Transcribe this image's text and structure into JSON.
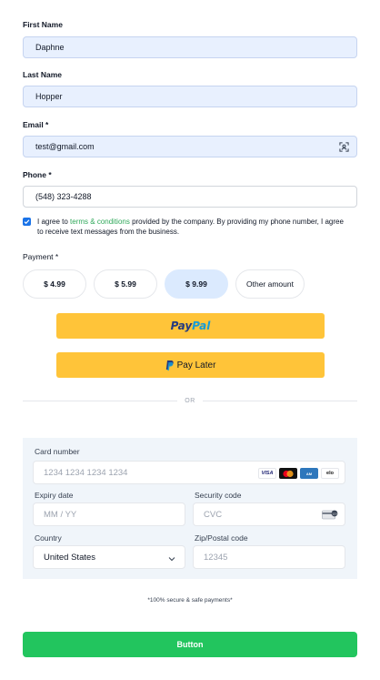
{
  "form": {
    "first_name": {
      "label": "First Name",
      "value": "Daphne"
    },
    "last_name": {
      "label": "Last Name",
      "value": "Hopper"
    },
    "email": {
      "label": "Email *",
      "value": "test@gmail.com"
    },
    "phone": {
      "label": "Phone *",
      "value": "(548) 323-4288"
    }
  },
  "consent": {
    "checked": true,
    "text_before": "I agree to ",
    "link": "terms & conditions",
    "text_after": " provided by the company. By providing my phone number, I agree to receive text messages from the business."
  },
  "payment": {
    "label": "Payment *",
    "amounts": [
      "$ 4.99",
      "$ 5.99",
      "$ 9.99",
      "Other amount"
    ],
    "selected": "$ 9.99"
  },
  "paypal": {
    "logo_part1": "Pay",
    "logo_part2": "Pal",
    "pay_later_label": "Pay Later",
    "button_color": "#ffc439"
  },
  "divider": {
    "text": "OR"
  },
  "card": {
    "number_label": "Card number",
    "number_placeholder": "1234 1234 1234 1234",
    "brands": [
      "VISA",
      "mastercard",
      "amex",
      "elo"
    ],
    "expiry_label": "Expiry date",
    "expiry_placeholder": "MM / YY",
    "cvc_label": "Security code",
    "cvc_placeholder": "CVC",
    "country_label": "Country",
    "country_value": "United States",
    "zip_label": "Zip/Postal code",
    "zip_placeholder": "12345"
  },
  "footer": {
    "secure_note": "*100% secure & safe payments*",
    "button_label": "Button",
    "button_color": "#22c55e"
  }
}
